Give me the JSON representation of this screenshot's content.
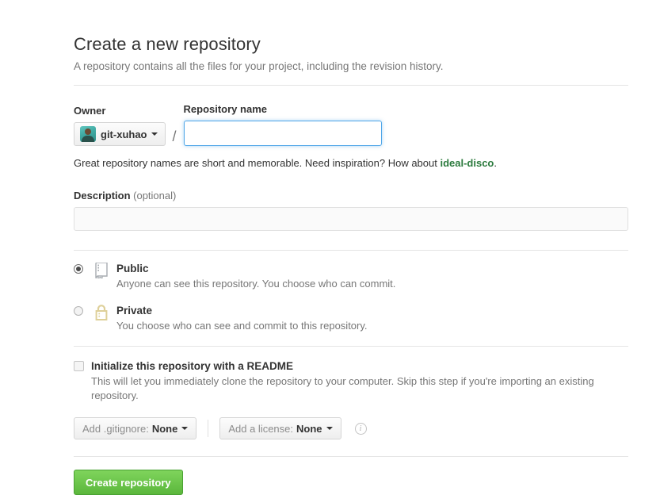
{
  "header": {
    "title": "Create a new repository",
    "subtitle": "A repository contains all the files for your project, including the revision history."
  },
  "owner": {
    "label": "Owner",
    "name": "git-xuhao",
    "avatar_icon": "user-avatar",
    "caret_icon": "chevron-down-icon",
    "separator": "/"
  },
  "repository_name": {
    "label": "Repository name",
    "value": "",
    "placeholder": "",
    "focused": true
  },
  "hint": {
    "prefix": "Great repository names are short and memorable. Need inspiration? How about ",
    "suggestion": "ideal-disco",
    "suffix": ".",
    "suggestion_color": "#2b7a3d"
  },
  "description": {
    "label": "Description",
    "optional_label": "(optional)",
    "value": "",
    "placeholder": ""
  },
  "visibility": {
    "options": [
      {
        "id": "public",
        "title": "Public",
        "description": "Anyone can see this repository. You choose who can commit.",
        "icon": "repo-book-icon",
        "icon_color": "#9aa0a6",
        "selected": true
      },
      {
        "id": "private",
        "title": "Private",
        "description": "You choose who can see and commit to this repository.",
        "icon": "lock-icon",
        "icon_color": "#e3d49a",
        "selected": false
      }
    ]
  },
  "readme": {
    "label": "Initialize this repository with a README",
    "description": "This will let you immediately clone the repository to your computer. Skip this step if you're importing an existing repository.",
    "checked": false
  },
  "gitignore": {
    "prefix": "Add .gitignore:",
    "value": "None",
    "caret_icon": "chevron-down-icon"
  },
  "license": {
    "prefix": "Add a license:",
    "value": "None",
    "caret_icon": "chevron-down-icon"
  },
  "info": {
    "icon": "info-icon",
    "glyph": "i"
  },
  "submit": {
    "label": "Create repository",
    "color": "#5bb73c"
  }
}
